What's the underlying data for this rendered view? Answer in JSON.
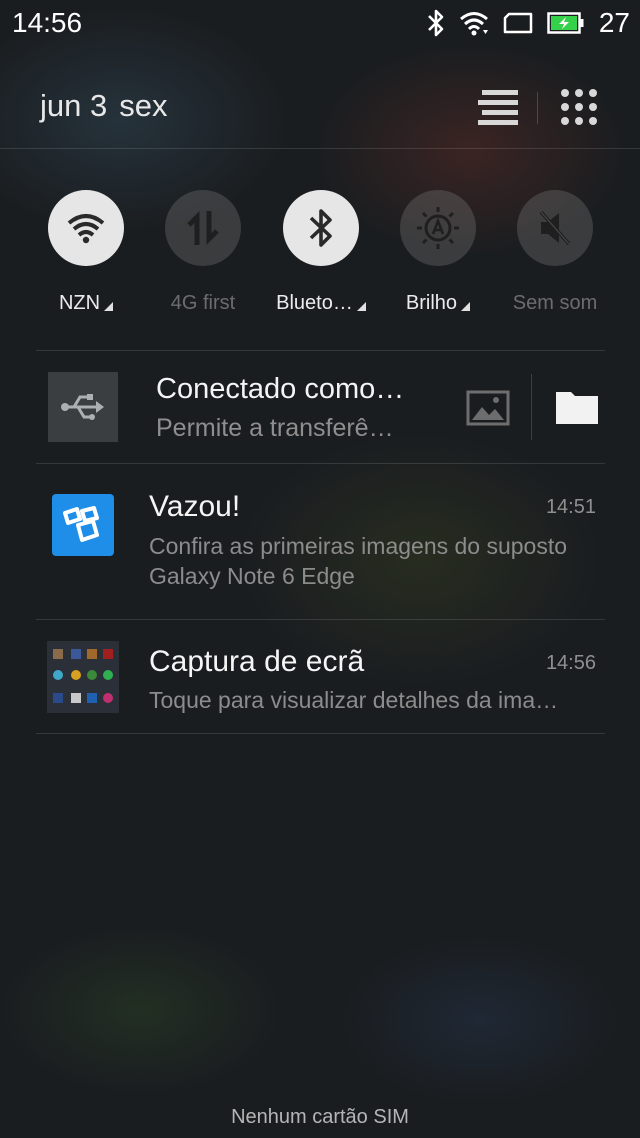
{
  "status_bar": {
    "time": "14:56",
    "battery_level": "27",
    "icons": [
      "bluetooth-icon",
      "wifi-icon",
      "screen-rotation-icon",
      "battery-charging-icon"
    ],
    "battery_color": "#35d14a"
  },
  "header": {
    "date": "jun 3",
    "weekday": "sex",
    "icons": [
      "list-view-icon",
      "apps-grid-icon"
    ]
  },
  "toggles": [
    {
      "label": "NZN",
      "state": "on",
      "icon": "wifi-icon",
      "has_menu": true
    },
    {
      "label": "4G first",
      "state": "off",
      "icon": "data-transfer-icon",
      "has_menu": false
    },
    {
      "label": "Blueto…",
      "state": "on",
      "icon": "bluetooth-icon",
      "has_menu": true
    },
    {
      "label": "Brilho",
      "state": "off",
      "icon": "auto-brightness-icon",
      "has_menu": true
    },
    {
      "label": "Sem som",
      "state": "off",
      "icon": "mute-icon",
      "has_menu": false
    }
  ],
  "notifications": {
    "usb": {
      "title": "Conectado como…",
      "text": "Permite a transferê…",
      "icon": "usb-icon",
      "actions": [
        "photo-icon",
        "folder-icon"
      ]
    },
    "items": [
      {
        "title": "Vazou!",
        "time": "14:51",
        "text": "Confira as primeiras imagens do suposto Galaxy Note 6 Edge",
        "icon": "tecmundo-app-icon",
        "icon_color": "#1f8ee8"
      },
      {
        "title": "Captura de ecrã",
        "time": "14:56",
        "text": "Toque para visualizar detalhes da ima…",
        "icon": "screenshot-thumbnail-icon"
      }
    ]
  },
  "footer": {
    "sim_status": "Nenhum cartão SIM"
  }
}
